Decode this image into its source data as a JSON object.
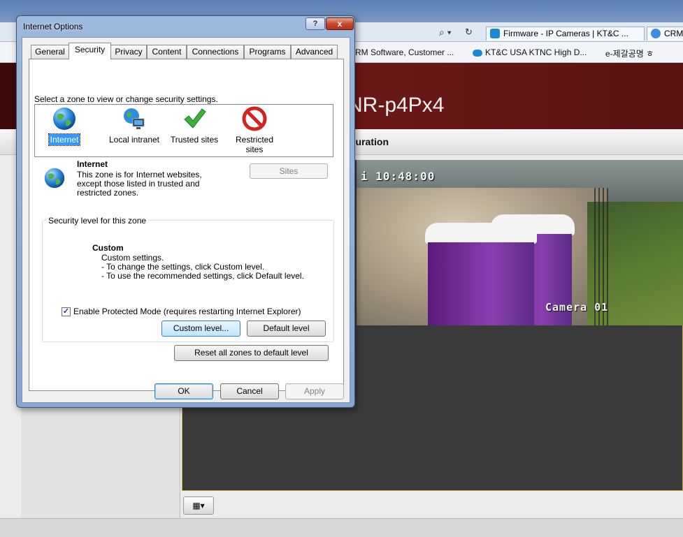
{
  "browser": {
    "tabs": [
      {
        "label": "Firmware - IP Cameras | KT&C ...",
        "icon": "ktnc-logo-icon"
      },
      {
        "label": "CRM",
        "icon": "ie-icon"
      }
    ],
    "favorites": [
      {
        "label": "RM Software, Customer ..."
      },
      {
        "label": "KT&C USA  KTNC  High D..."
      },
      {
        "label": "e-제갈공명 ㅎ"
      }
    ]
  },
  "web_page": {
    "header_title": "NR-p4Px4",
    "config_label": "guration",
    "video": {
      "timestamp": "i 10:48:00",
      "camera_label": "Camera 01"
    },
    "layout_button_icon": "grid-layout-icon"
  },
  "dialog": {
    "title": "Internet Options",
    "help_label": "?",
    "close_label": "x",
    "tabs": [
      {
        "label": "General"
      },
      {
        "label": "Security"
      },
      {
        "label": "Privacy"
      },
      {
        "label": "Content"
      },
      {
        "label": "Connections"
      },
      {
        "label": "Programs"
      },
      {
        "label": "Advanced"
      }
    ],
    "active_tab": "Security",
    "zone_prompt": "Select a zone to view or change security settings.",
    "zones": [
      {
        "label": "Internet",
        "icon": "globe-icon"
      },
      {
        "label": "Local intranet",
        "icon": "network-globe-icon"
      },
      {
        "label": "Trusted sites",
        "icon": "green-check-icon"
      },
      {
        "label": "Restricted sites",
        "icon": "red-prohibited-icon"
      }
    ],
    "selected_zone": "Internet",
    "zone_info": {
      "title": "Internet",
      "description": "This zone is for Internet websites, except those listed in trusted and restricted zones."
    },
    "sites_button": "Sites",
    "security_level": {
      "legend": "Security level for this zone",
      "level_name": "Custom",
      "lines": [
        "Custom settings.",
        "- To change the settings, click Custom level.",
        "- To use the recommended settings, click Default level."
      ]
    },
    "protected_mode": {
      "label": "Enable Protected Mode (requires restarting Internet Explorer)",
      "checked": true,
      "check_mark": "✓"
    },
    "custom_level_button": "Custom level...",
    "default_level_button": "Default level",
    "reset_all_button": "Reset all zones to default level",
    "ok_button": "OK",
    "cancel_button": "Cancel",
    "apply_button": "Apply"
  }
}
